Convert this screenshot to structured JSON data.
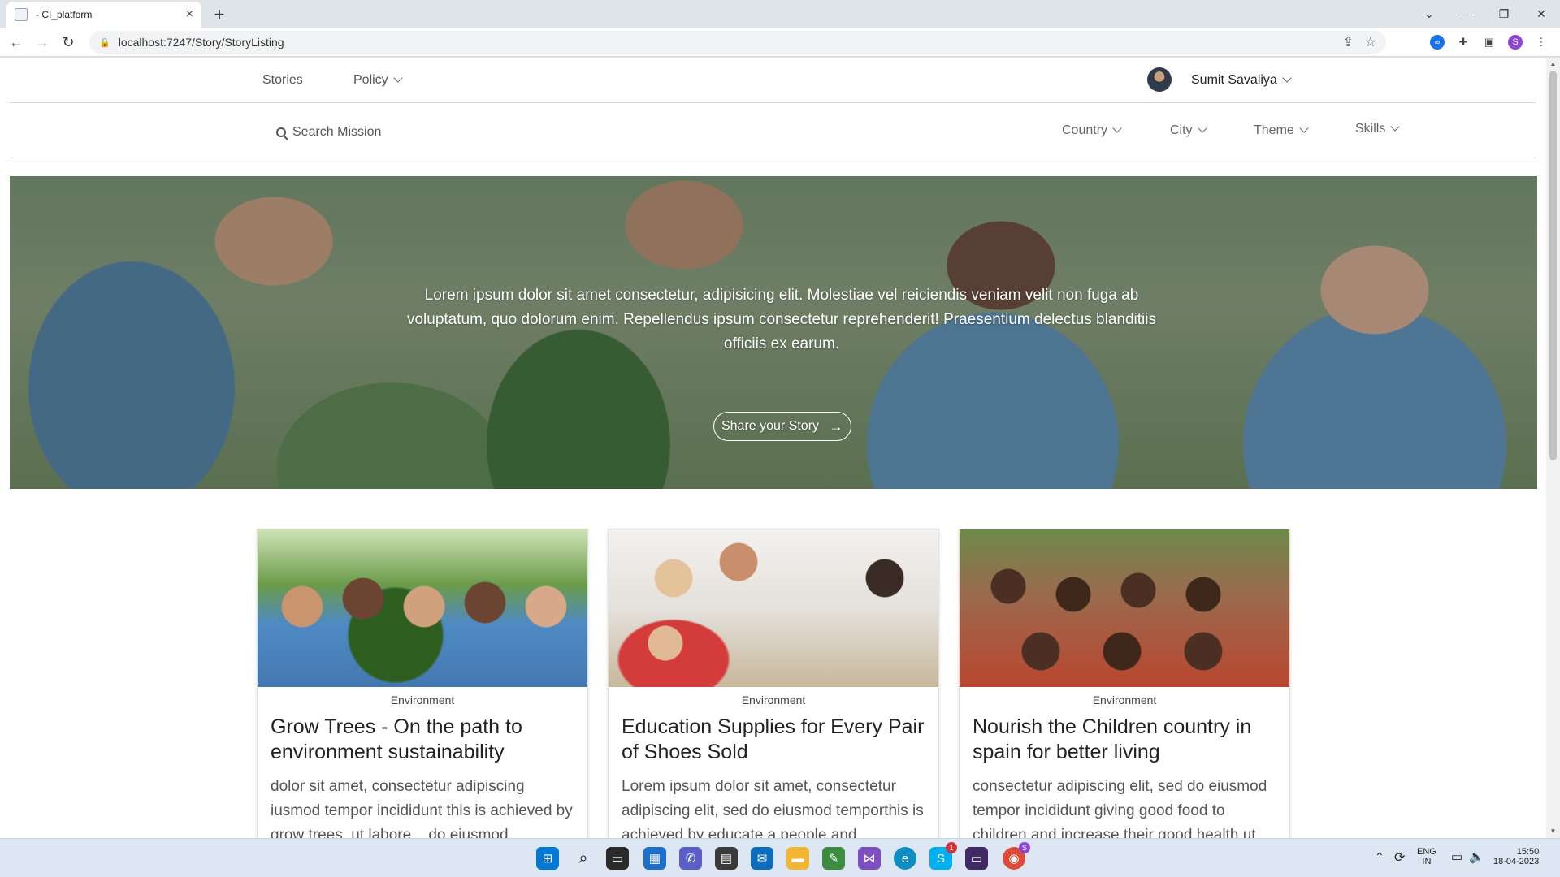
{
  "browser": {
    "tab_title": "- CI_platform",
    "url": "localhost:7247/Story/StoryListing",
    "profile_initial": "S"
  },
  "nav": {
    "stories": "Stories",
    "policy": "Policy",
    "user_name": "Sumit Savaliya"
  },
  "filters": {
    "search_placeholder": "Search Mission",
    "country": "Country",
    "city": "City",
    "theme": "Theme",
    "skills": "Skills"
  },
  "hero": {
    "text": "Lorem ipsum dolor sit amet consectetur, adipisicing elit. Molestiae vel reiciendis veniam velit non fuga ab voluptatum, quo dolorum enim. Repellendus ipsum consectetur reprehenderit! Praesentium delectus blanditiis officiis ex earum.",
    "button": "Share your Story"
  },
  "stories": [
    {
      "theme": "Environment",
      "title": "Grow Trees - On the path to environment sustainability",
      "description": "dolor sit amet, consectetur adipiscing iusmod tempor incididunt this is achieved by grow trees. ut labore... do eiusmod"
    },
    {
      "theme": "Environment",
      "title": "Education Supplies for Every Pair of Shoes Sold",
      "description": "Lorem ipsum dolor sit amet, consectetur adipiscing elit, sed do eiusmod temporthis is achieved by educate a people and"
    },
    {
      "theme": "Environment",
      "title": "Nourish the Children country in spain for better living",
      "description": "consectetur adipiscing elit, sed do eiusmod tempor incididunt giving good food to children and increase their good health ut"
    }
  ],
  "taskbar": {
    "skype_badge": "1",
    "chrome_badge": "S",
    "lang_top": "ENG",
    "lang_bottom": "IN",
    "time": "15:50",
    "date": "18-04-2023"
  },
  "colors": {
    "accent": "#1a73e8",
    "taskbar": "#dde6f3"
  }
}
